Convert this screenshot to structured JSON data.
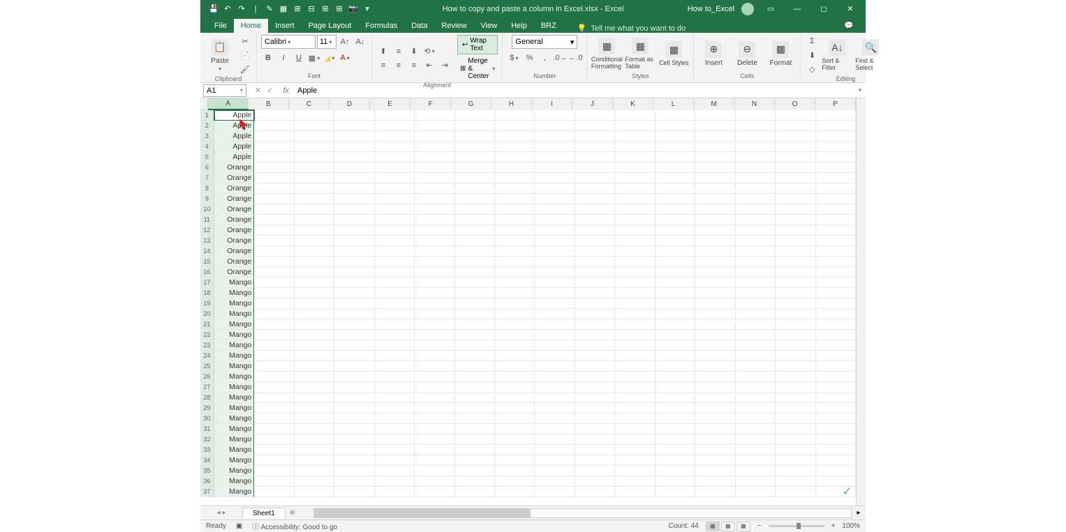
{
  "title": {
    "filename": "How to copy and paste a column in Excel.xlsx",
    "app": "Excel",
    "combined": "How to copy and paste a column in Excel.xlsx  -  Excel",
    "user": "How to_Excel"
  },
  "tabs": {
    "file": "File",
    "home": "Home",
    "insert": "Insert",
    "page_layout": "Page Layout",
    "formulas": "Formulas",
    "data": "Data",
    "review": "Review",
    "view": "View",
    "help": "Help",
    "brz": "BRZ",
    "tellme": "Tell me what you want to do"
  },
  "ribbon": {
    "clipboard": {
      "label": "Clipboard",
      "paste": "Paste"
    },
    "font": {
      "label": "Font",
      "name": "Calibri",
      "size": "11"
    },
    "alignment": {
      "label": "Alignment",
      "wrap": "Wrap Text",
      "merge": "Merge & Center"
    },
    "number": {
      "label": "Number",
      "format": "General"
    },
    "styles": {
      "label": "Styles",
      "cond": "Conditional Formatting",
      "fmtas": "Format as Table",
      "cellstyles": "Cell Styles"
    },
    "cells": {
      "label": "Cells",
      "insert": "Insert",
      "delete": "Delete",
      "format": "Format"
    },
    "editing": {
      "label": "Editing",
      "sort": "Sort & Filter",
      "find": "Find & Select"
    }
  },
  "namebox": "A1",
  "formula_value": "Apple",
  "columns": [
    "A",
    "B",
    "C",
    "D",
    "E",
    "F",
    "G",
    "H",
    "I",
    "J",
    "K",
    "L",
    "M",
    "N",
    "O",
    "P"
  ],
  "cells_a": [
    "Apple",
    "Apple",
    "Apple",
    "Apple",
    "Apple",
    "Orange",
    "Orange",
    "Orange",
    "Orange",
    "Orange",
    "Orange",
    "Orange",
    "Orange",
    "Orange",
    "Orange",
    "Orange",
    "Mango",
    "Mango",
    "Mango",
    "Mango",
    "Mango",
    "Mango",
    "Mango",
    "Mango",
    "Mango",
    "Mango",
    "Mango",
    "Mango",
    "Mango",
    "Mango",
    "Mango",
    "Mango",
    "Mango",
    "Mango",
    "Mango",
    "Mango",
    "Mango"
  ],
  "sheet": {
    "name": "Sheet1"
  },
  "status": {
    "ready": "Ready",
    "accessibility": "Accessibility: Good to go",
    "count": "Count: 44",
    "zoom": "100%"
  }
}
